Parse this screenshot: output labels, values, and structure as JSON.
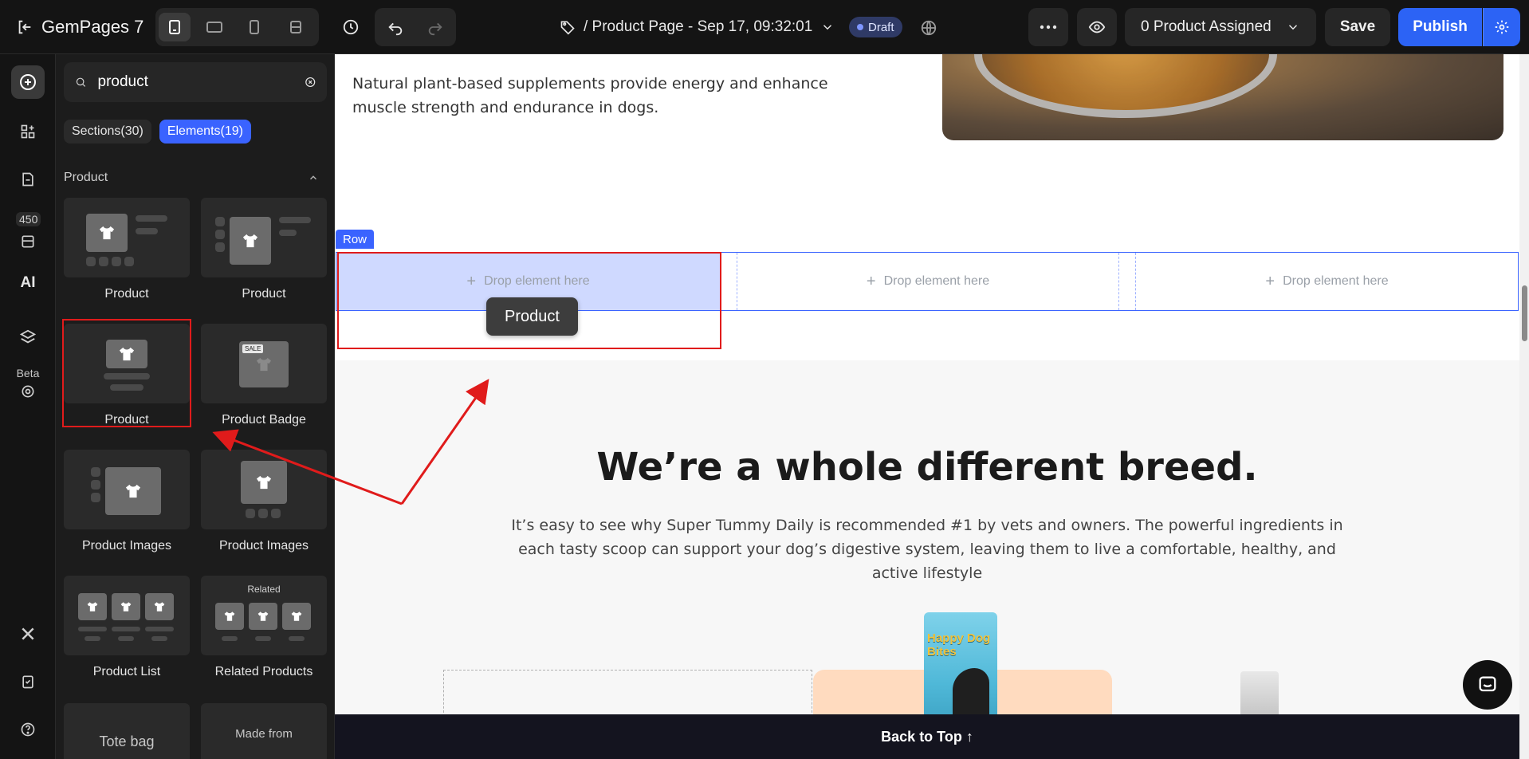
{
  "topbar": {
    "logo_text": "GemPages 7",
    "page_title": "/ Product Page - Sep 17, 09:32:01",
    "draft_label": "Draft",
    "assign_label": "0 Product Assigned",
    "save_label": "Save",
    "publish_label": "Publish"
  },
  "rail": {
    "badge_count": "450",
    "ai_label": "AI",
    "beta_label": "Beta"
  },
  "panel": {
    "search_value": "product",
    "tabs": [
      {
        "label": "Sections(30)"
      },
      {
        "label": "Elements(19)"
      }
    ],
    "category": "Product",
    "cards": [
      {
        "label": "Product"
      },
      {
        "label": "Product"
      },
      {
        "label": "Product"
      },
      {
        "label": "Product Badge"
      },
      {
        "label": "Product Images"
      },
      {
        "label": "Product Images"
      },
      {
        "label": "Product List"
      },
      {
        "label": "Related Products"
      },
      {
        "label": "Tote bag"
      },
      {
        "label": "Made from"
      }
    ],
    "badge_sale": "SALE",
    "related_thumb_label": "Related"
  },
  "canvas": {
    "intro_text": "Natural plant-based supplements provide energy and enhance muscle strength and endurance in dogs.",
    "row_tag": "Row",
    "drop_label": "Drop element here",
    "drag_chip": "Product",
    "headline": "We’re a whole different breed.",
    "subcopy": "It’s easy to see why Super Tummy Daily is recommended #1 by vets and owners. The powerful ingredients in each tasty scoop can support your dog’s digestive system, leaving them to live a comfortable, healthy, and active lifestyle",
    "bag_text": "Happy Dog Bites",
    "back_to_top": "Back to Top ↑"
  },
  "colors": {
    "accent": "#3a63ff",
    "publish": "#2c63f5",
    "annotation_red": "#e01b1b",
    "drop_highlight": "#cfd9ff"
  }
}
